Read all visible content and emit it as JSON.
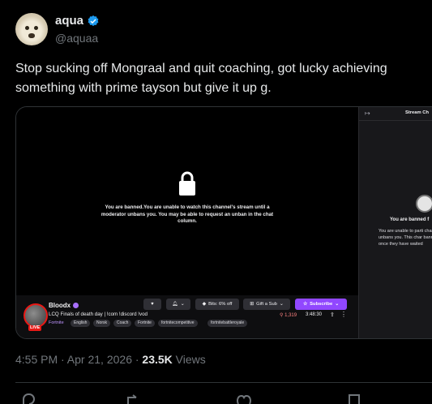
{
  "author": {
    "name": "aqua",
    "handle": "@aquaa"
  },
  "tweet": {
    "text": "Stop sucking off Mongraal and quit coaching, got lucky achieving something with prime tayson but give it up g."
  },
  "stream": {
    "ban_message": "You are banned.You are unable to watch this channel's stream until a moderator unbans you. You may be able to request an unban in the chat column.",
    "streamer": "Bloodx",
    "title": "LCQ Finals of death day | !com !discord !vod",
    "game": "Fortnite",
    "live_label": "LIVE",
    "tags": [
      "English",
      "Norsk",
      "Coach",
      "Fortnite",
      "fortnitecompetitive",
      "fortnitebattleroyale"
    ],
    "bits_label": "Bits: 6% off",
    "gift_label": "Gift a Sub",
    "subscribe_label": "Subscribe",
    "viewers": "1,319",
    "uptime": "3:48:30"
  },
  "chat": {
    "title": "Stream Ch",
    "banned_title": "You are banned f",
    "banned_body": "You are unable to parti channel's chat until a unbans you. This char banned users to reque once they have waited"
  },
  "meta": {
    "time": "4:55 PM · Apr 21, 2026 · ",
    "views": "23.5K",
    "views_label": " Views"
  },
  "colors": {
    "accent": "#1d9bf0",
    "twitch_purple": "#9147ff",
    "live_red": "#e91916"
  }
}
